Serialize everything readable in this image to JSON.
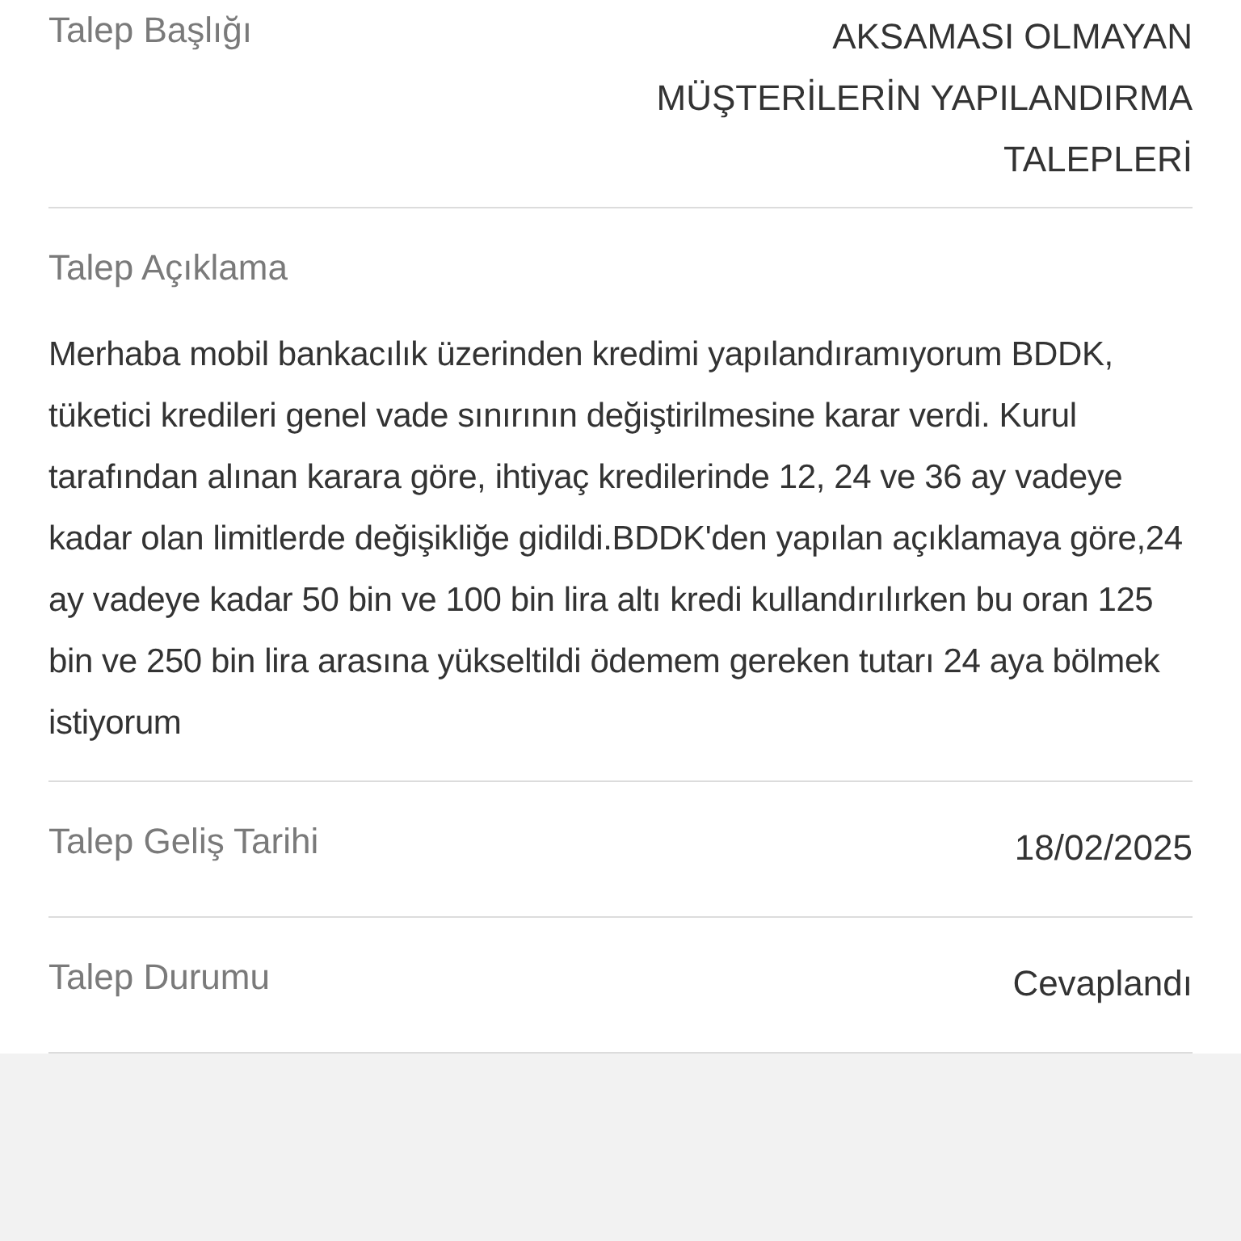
{
  "fields": [
    {
      "kind": "pair",
      "label": "Talep Başlığı",
      "value": "AKSAMASI OLMAYAN MÜŞTERİLERİN YAPILANDIRMA TALEPLERİ"
    },
    {
      "kind": "block",
      "label": "Talep Açıklama",
      "value": "Merhaba mobil bankacılık üzerinden kredimi yapılandıramıyorum BDDK, tüketici kredileri genel vade sınırının değiştirilmesine karar verdi. Kurul tarafından alınan karara göre, ihtiyaç kredilerinde 12, 24 ve 36 ay vadeye kadar olan limitlerde değişikliğe gidildi.BDDK'den yapılan açıklamaya göre,24 ay vadeye kadar 50 bin ve 100 bin lira altı kredi kullandırılırken bu oran 125 bin ve 250 bin lira arasına yükseltildi ödemem gereken tutarı 24 aya bölmek istiyorum"
    },
    {
      "kind": "pair",
      "label": "Talep Geliş Tarihi",
      "value": "18/02/2025"
    },
    {
      "kind": "pair",
      "label": "Talep Durumu",
      "value": "Cevaplandı"
    }
  ]
}
